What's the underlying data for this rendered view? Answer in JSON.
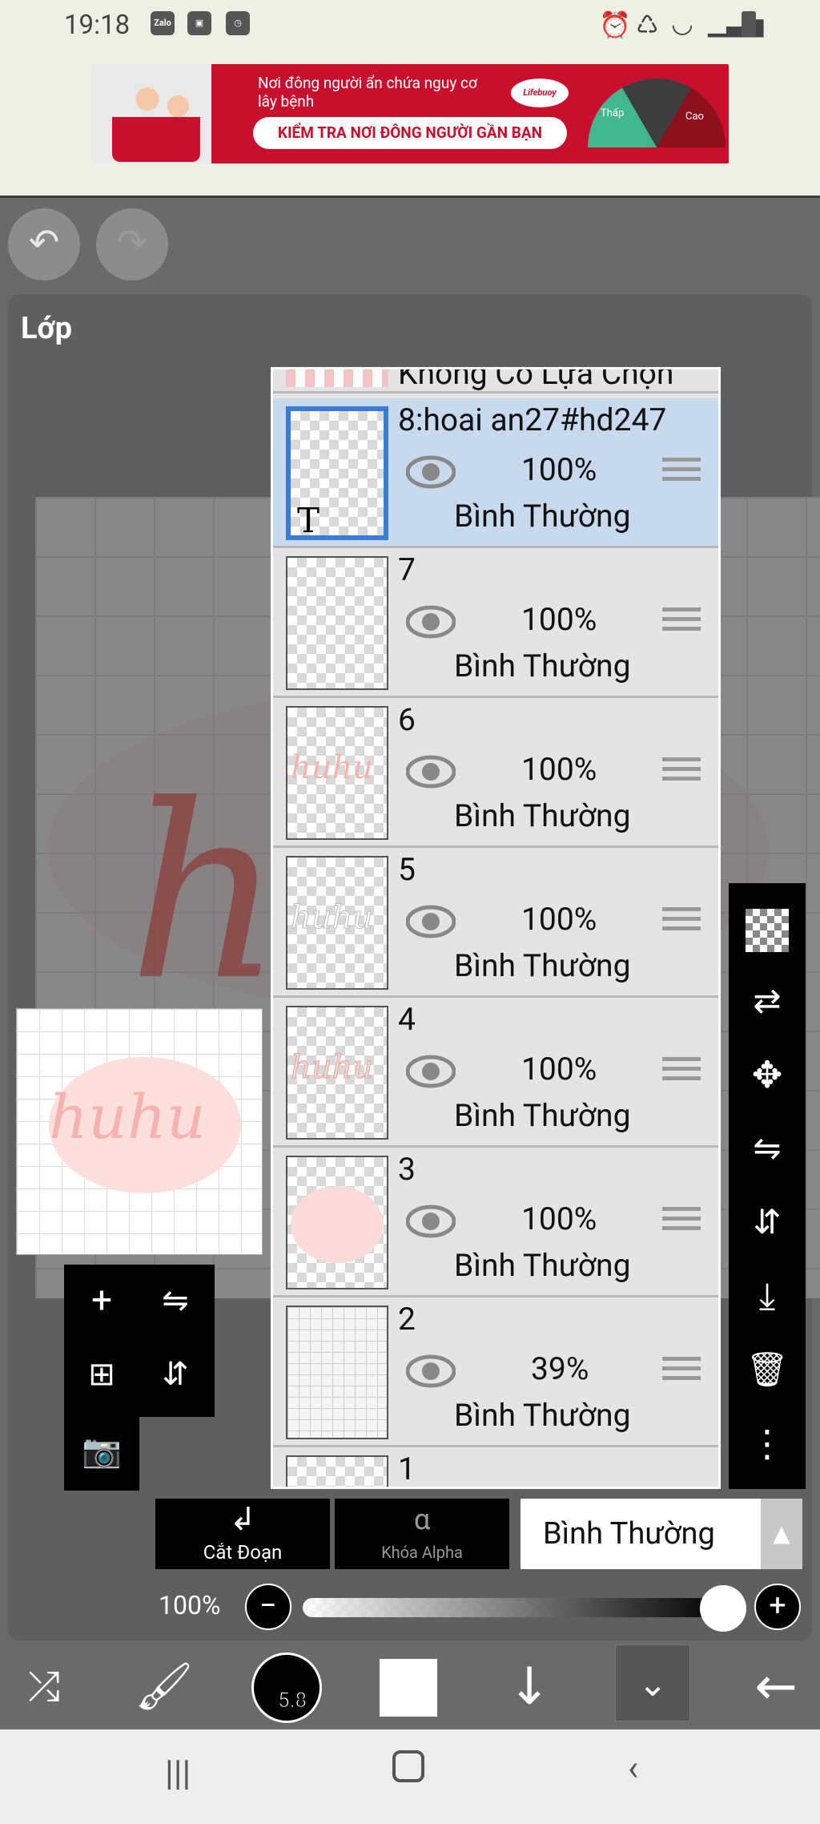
{
  "status": {
    "time": "19:18",
    "app_badge": "Zalo"
  },
  "ad": {
    "line1": "Nơi đông người ẩn chứa nguy cơ lây bệnh",
    "button": "KIỂM TRA NƠI ĐÔNG NGƯỜI GẦN BẠN",
    "brand": "Lifebuoy",
    "gauge_low": "Thấp",
    "gauge_high": "Cao"
  },
  "panel": {
    "title": "Lớp"
  },
  "layers": {
    "top_partial": "Không Có Lựa Chọn",
    "items": [
      {
        "name": "8:hoai an27#hd247",
        "opacity": "100%",
        "mode": "Bình Thường",
        "selected": true
      },
      {
        "name": "7",
        "opacity": "100%",
        "mode": "Bình Thường"
      },
      {
        "name": "6",
        "opacity": "100%",
        "mode": "Bình Thường"
      },
      {
        "name": "5",
        "opacity": "100%",
        "mode": "Bình Thường"
      },
      {
        "name": "4",
        "opacity": "100%",
        "mode": "Bình Thường"
      },
      {
        "name": "3",
        "opacity": "100%",
        "mode": "Bình Thường"
      },
      {
        "name": "2",
        "opacity": "39%",
        "mode": "Bình Thường"
      },
      {
        "name": "1"
      }
    ]
  },
  "preview_text": "huhu",
  "canvas_letter": "h",
  "bottom_controls": {
    "clip_label": "Cắt Đoạn",
    "alpha_lock_label": "Khóa Alpha",
    "blend_mode": "Bình Thường",
    "opacity_label": "100%"
  },
  "toolbar": {
    "brush_size": "5.8"
  }
}
